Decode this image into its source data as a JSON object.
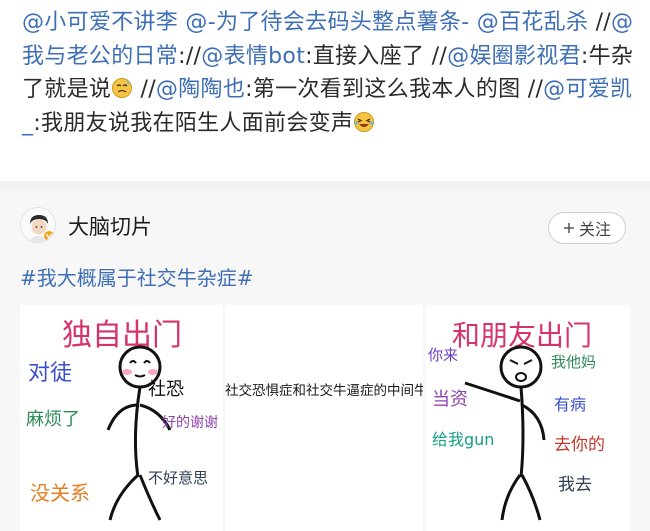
{
  "repost": {
    "m1": "@小可爱不讲李",
    "m2": "@-为了待会去码头整点薯条-",
    "m3": "@百花乱杀",
    "sep1": " //",
    "m4": "@我与老公的日常",
    "t4": ":",
    "sep2": "//",
    "m5": "@表情bot",
    "t5": ":直接入座了 //",
    "m6": "@娱圈影视君",
    "t6": ":牛杂了就是说",
    "sep3": " //",
    "m7": "@陶陶也",
    "t7": ":第一次看到这么我本人的图 //",
    "m8": "@可爱凯_",
    "t8": ":我朋友说我在陌生人面前会变声"
  },
  "card": {
    "author": "大脑切片",
    "follow_label": "关注",
    "hashtag": "#我大概属于社交牛杂症#",
    "middle_caption": "社交恐惧症和社交牛逼症的中间牛杂症",
    "left_image": {
      "title": "独自出门",
      "words": [
        "对徒",
        "麻烦了",
        "没关系",
        "社恐",
        "好的谢谢",
        "不好意思"
      ]
    },
    "right_image": {
      "title": "和朋友出门",
      "words": [
        "你来",
        "我他妈",
        "有病",
        "去你的",
        "我去",
        "给我gun",
        "当资"
      ]
    }
  },
  "colors": {
    "link": "#3e6fb6",
    "text": "#2b2b2b",
    "separator": "#f2f2f2",
    "card_bg": "#f7f7f7"
  },
  "icons": [
    "avatar",
    "verified-badge-icon",
    "sweating-emoji-icon",
    "laughing-emoji-icon",
    "plus-icon"
  ]
}
